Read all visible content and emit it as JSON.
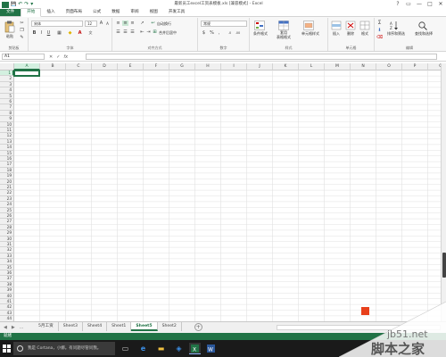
{
  "window": {
    "title": "最新员工excel工资表模板.xls [兼容模式] - Excel",
    "help": "?",
    "restore": "▭",
    "minimize": "—",
    "maximize": "□",
    "close": "✕"
  },
  "qat": {
    "logo": "X",
    "save": "💾",
    "undo": "↶",
    "redo": "↷",
    "more": "▾"
  },
  "ribbon_tabs": [
    "文件",
    "开始",
    "插入",
    "页面布局",
    "公式",
    "数据",
    "审阅",
    "视图",
    "开发工具"
  ],
  "ribbon": {
    "clipboard": {
      "label": "剪贴板",
      "paste": "粘贴"
    },
    "font": {
      "label": "字体",
      "font_name": "宋体",
      "font_size": "12",
      "bold": "B",
      "italic": "I",
      "underline": "U",
      "grow": "A",
      "shrink": "A",
      "font_color_glyph": "A",
      "fill_glyph": "◆"
    },
    "alignment": {
      "label": "对齐方式",
      "wrap": "自动换行",
      "merge": "合并后居中"
    },
    "number": {
      "label": "数字",
      "format": "常规",
      "percent": "%",
      "comma": ",",
      "currency": "$"
    },
    "styles": {
      "label": "样式",
      "conditional": "条件格式",
      "table": "套用\n表格格式",
      "cell_styles": "单元格样式"
    },
    "cells": {
      "label": "单元格",
      "insert": "插入",
      "delete": "删除",
      "format": "格式"
    },
    "editing": {
      "label": "编辑",
      "sort": "排序和筛选",
      "find": "查找和选择",
      "sum": "Σ"
    }
  },
  "formula_bar": {
    "name_box": "A1",
    "cancel": "✕",
    "enter": "✓",
    "fx": "fx",
    "value": ""
  },
  "columns": [
    "A",
    "B",
    "C",
    "D",
    "E",
    "F",
    "G",
    "H",
    "I",
    "J",
    "K",
    "L",
    "M",
    "N",
    "O",
    "P",
    "Q"
  ],
  "rows": [
    "1",
    "2",
    "3",
    "4",
    "5",
    "6",
    "7",
    "8",
    "9",
    "10",
    "11",
    "12",
    "13",
    "14",
    "15",
    "16",
    "17",
    "18",
    "19",
    "20",
    "21",
    "22",
    "23",
    "24",
    "25",
    "26",
    "27",
    "28",
    "29",
    "30",
    "31",
    "32",
    "33",
    "34",
    "35",
    "36",
    "37",
    "38",
    "39",
    "40",
    "41",
    "42",
    "43",
    "44"
  ],
  "selected_cell": {
    "column": "A",
    "row": "1"
  },
  "sheet_nav": {
    "prev": "◀",
    "next": "▶",
    "more": "..."
  },
  "sheets": [
    "5月工资",
    "Sheet3",
    "Sheet4",
    "Sheet1",
    "Sheet5",
    "Sheet2"
  ],
  "active_sheet": "Sheet5",
  "add_sheet": "+",
  "status": {
    "text": "就绪"
  },
  "taskbar": {
    "search_text": "我是 Cortana，小娜。有问题尽管问我。",
    "icons": [
      "task-view",
      "edge",
      "file-explorer",
      "store",
      "excel",
      "word"
    ]
  },
  "watermark": {
    "url": "jb51.net",
    "text": "脚本之家"
  },
  "colors": {
    "excel_green": "#217346",
    "taskbar": "#1a1a1a",
    "header_bg": "#f0f0f0",
    "gridline": "#e1e1e1"
  }
}
